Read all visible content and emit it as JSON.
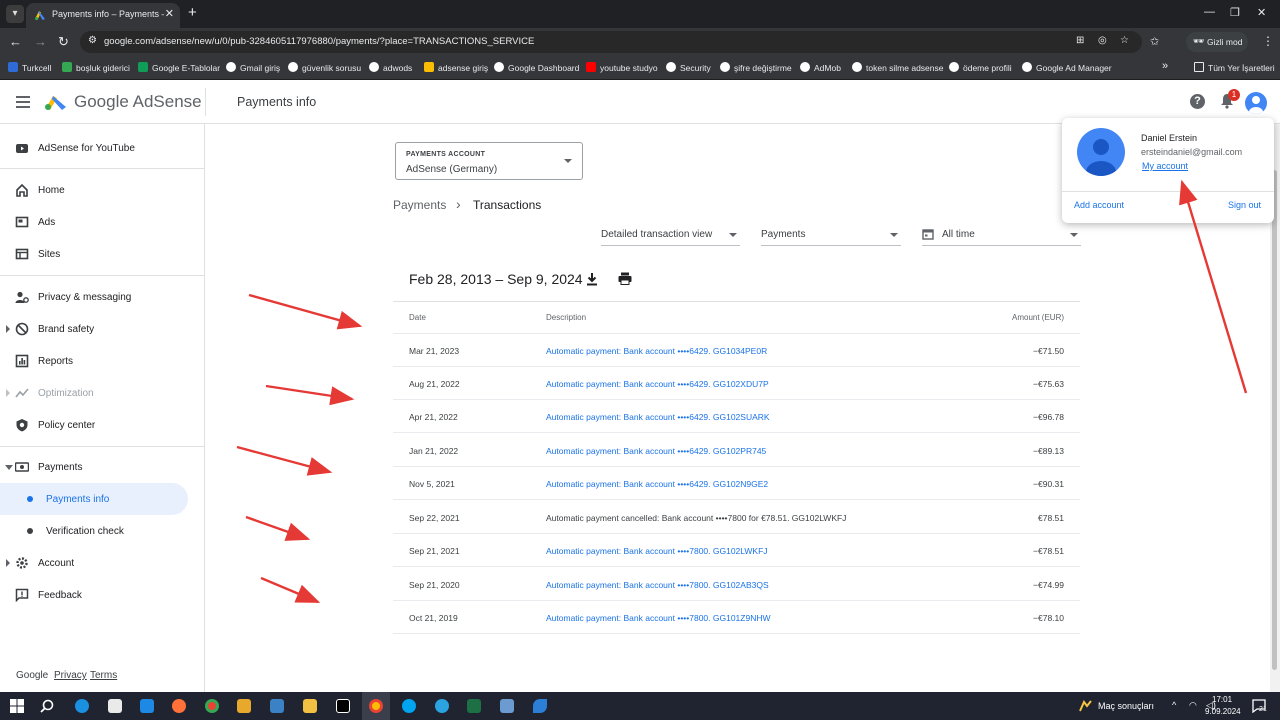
{
  "browser": {
    "tab_title": "Payments info – Payments – Go",
    "url": "google.com/adsense/new/u/0/pub-3284605117976880/payments/?place=TRANSACTIONS_SERVICE",
    "incognito_label": "Gizli mod",
    "bookmarks": [
      "Turkcell",
      "boşluk giderici",
      "Google E-Tablolar",
      "Gmail giriş",
      "güvenlik sorusu",
      "adwods",
      "adsense giriş",
      "Google Dashboard",
      "youtube studyo",
      "Security",
      "şifre değiştirme",
      "AdMob",
      "token silme adsense",
      "ödeme profili",
      "Google Ad Manager"
    ],
    "bookmarks_overflow": "»",
    "all_bookmarks": "Tüm Yer İşaretleri"
  },
  "header": {
    "brand": "Google AdSense",
    "page_title": "Payments info",
    "notification_count": "1"
  },
  "sidebar": {
    "items": [
      {
        "label": "AdSense for YouTube",
        "icon": "youtube-icon"
      },
      {
        "label": "Home",
        "icon": "home-icon"
      },
      {
        "label": "Ads",
        "icon": "ads-icon"
      },
      {
        "label": "Sites",
        "icon": "sites-icon"
      },
      {
        "label": "Privacy & messaging",
        "icon": "privacy-icon"
      },
      {
        "label": "Brand safety",
        "icon": "block-icon"
      },
      {
        "label": "Reports",
        "icon": "reports-icon"
      },
      {
        "label": "Optimization",
        "icon": "optimization-icon"
      },
      {
        "label": "Policy center",
        "icon": "policy-icon"
      },
      {
        "label": "Payments",
        "icon": "payments-icon"
      },
      {
        "label": "Payments info",
        "icon": ""
      },
      {
        "label": "Verification check",
        "icon": ""
      },
      {
        "label": "Account",
        "icon": "gear-icon"
      },
      {
        "label": "Feedback",
        "icon": "feedback-icon"
      }
    ],
    "footer": {
      "google": "Google",
      "privacy": "Privacy",
      "terms": "Terms"
    }
  },
  "main": {
    "account_selector": {
      "label": "PAYMENTS ACCOUNT",
      "value": "AdSense (Germany)"
    },
    "breadcrumb": {
      "parent": "Payments",
      "separator": "›",
      "current": "Transactions"
    },
    "filters": {
      "view": "Detailed transaction view",
      "type": "Payments",
      "time": "All time"
    },
    "date_range": "Feb 28, 2013 – Sep 9, 2024",
    "table": {
      "headers": {
        "date": "Date",
        "description": "Description",
        "amount": "Amount (EUR)"
      },
      "rows": [
        {
          "date": "Mar 21, 2023",
          "description": "Automatic payment: Bank account  ••••6429. GG1034PE0R",
          "amount": "−€71.50",
          "link": true
        },
        {
          "date": "Aug 21, 2022",
          "description": "Automatic payment: Bank account  ••••6429. GG102XDU7P",
          "amount": "−€75.63",
          "link": true
        },
        {
          "date": "Apr 21, 2022",
          "description": "Automatic payment: Bank account  ••••6429. GG102SUARK",
          "amount": "−€96.78",
          "link": true
        },
        {
          "date": "Jan 21, 2022",
          "description": "Automatic payment: Bank account  ••••6429. GG102PR745",
          "amount": "−€89.13",
          "link": true
        },
        {
          "date": "Nov 5, 2021",
          "description": "Automatic payment: Bank account  ••••6429. GG102N9GE2",
          "amount": "−€90.31",
          "link": true
        },
        {
          "date": "Sep 22, 2021",
          "description": "Automatic payment cancelled: Bank account  ••••7800 for €78.51. GG102LWKFJ",
          "amount": "€78.51",
          "link": false
        },
        {
          "date": "Sep 21, 2021",
          "description": "Automatic payment: Bank account  ••••7800. GG102LWKFJ",
          "amount": "−€78.51",
          "link": true
        },
        {
          "date": "Sep 21, 2020",
          "description": "Automatic payment: Bank account  ••••7800. GG102AB3QS",
          "amount": "−€74.99",
          "link": true
        },
        {
          "date": "Oct 21, 2019",
          "description": "Automatic payment: Bank account  ••••7800. GG101Z9NHW",
          "amount": "−€78.10",
          "link": true
        }
      ]
    }
  },
  "account_popup": {
    "name": "Daniel Erstein",
    "email": "ersteindaniel@gmail.com",
    "my_account": "My account",
    "add_account": "Add account",
    "sign_out": "Sign out"
  },
  "taskbar": {
    "weather": "Maç sonuçları",
    "time": "17:01",
    "date": "9.09.2024",
    "notifications": "21"
  },
  "colors": {
    "accent": "#1a73e8",
    "annotation_arrow": "#e53935",
    "active_nav_bg": "#e8f0fe"
  }
}
